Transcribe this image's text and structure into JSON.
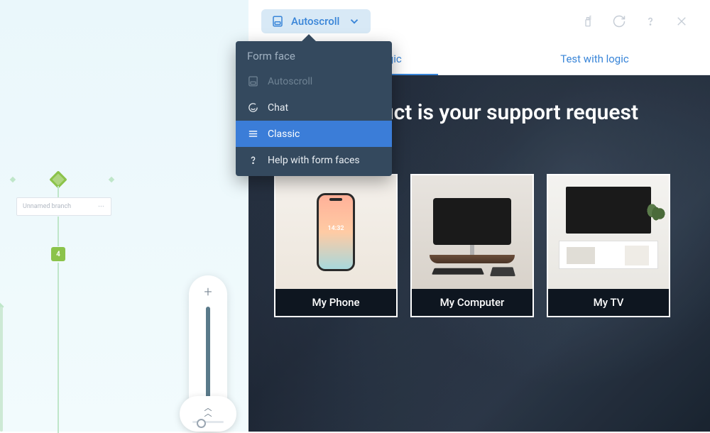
{
  "toolbar": {
    "autoscroll_label": "Autoscroll"
  },
  "tabs": {
    "all_without_logic": "All without logic",
    "test_with_logic": "Test with logic"
  },
  "dropdown": {
    "header": "Form face",
    "items": [
      {
        "icon": "autoscroll-icon",
        "label": "Autoscroll"
      },
      {
        "icon": "chat-icon",
        "label": "Chat"
      },
      {
        "icon": "classic-icon",
        "label": "Classic"
      },
      {
        "icon": "help-icon",
        "label": "Help with form faces"
      }
    ]
  },
  "preview": {
    "question": "Which product is your support request about?",
    "options": [
      {
        "label": "My Phone",
        "phone_time": "14:32"
      },
      {
        "label": "My Computer"
      },
      {
        "label": "My TV"
      }
    ]
  },
  "canvas": {
    "branch_label": "Unnamed branch",
    "question_node_number": "4"
  },
  "zoom": {
    "plus": "+"
  }
}
